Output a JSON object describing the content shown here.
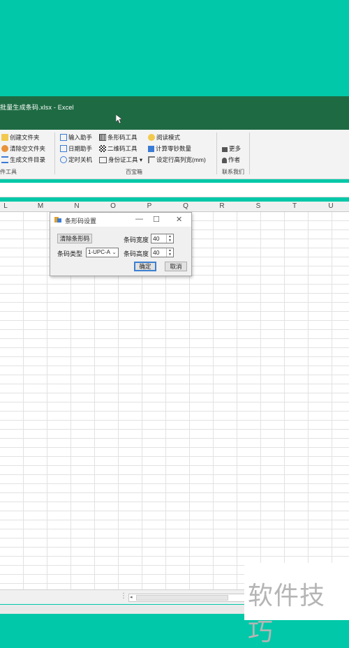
{
  "window": {
    "title": "批量生成条码.xlsx  -  Excel"
  },
  "ribbon": {
    "col1": [
      "创建文件夹",
      "清除空文件夹",
      "生成文件目录"
    ],
    "col1_group": "件工具",
    "col2": [
      "输入助手",
      "日期助手",
      "定时关机"
    ],
    "col3": [
      "条形码工具",
      "二维码工具",
      "身份证工具 ▾"
    ],
    "col4": [
      "阅读模式",
      "计算零钞数量",
      "设定行高列宽(mm)"
    ],
    "group_baobao": "百宝箱",
    "col5": [
      "更多",
      "作者"
    ],
    "group_contact": "联系我们"
  },
  "columns": [
    "L",
    "M",
    "N",
    "O",
    "P",
    "Q",
    "R",
    "S",
    "T",
    "U"
  ],
  "dialog": {
    "title": "条形码设置",
    "minimize": "—",
    "maximize": "☐",
    "close": "✕",
    "clear_button": "清除条形码",
    "width_label": "条码宽度",
    "width_value": "40",
    "type_label": "条码类型",
    "type_value": "1-UPC-A",
    "height_label": "条码高度",
    "height_value": "40",
    "ok_button": "确定",
    "cancel_button": "取消"
  },
  "watermark": "软件技巧",
  "colors": {
    "title_bar": "#1e6b43",
    "background": "#00c8a8"
  }
}
